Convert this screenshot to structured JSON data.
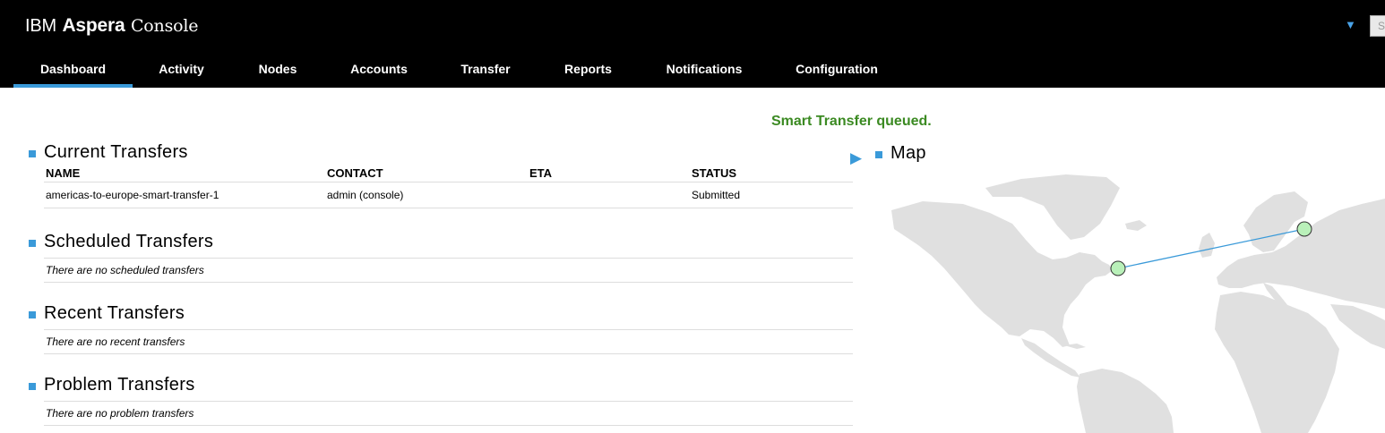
{
  "header": {
    "brand_ibm": "IBM",
    "brand_aspera": "Aspera",
    "brand_console": "Console",
    "search_stub": "S"
  },
  "nav": [
    {
      "label": "Dashboard",
      "active": true
    },
    {
      "label": "Activity"
    },
    {
      "label": "Nodes"
    },
    {
      "label": "Accounts"
    },
    {
      "label": "Transfer"
    },
    {
      "label": "Reports"
    },
    {
      "label": "Notifications"
    },
    {
      "label": "Configuration"
    }
  ],
  "status_message": "Smart Transfer queued.",
  "current_transfers": {
    "title": "Current Transfers",
    "columns": [
      "NAME",
      "CONTACT",
      "ETA",
      "STATUS"
    ],
    "rows": [
      {
        "name": "americas-to-europe-smart-transfer-1",
        "contact": "admin (console)",
        "eta": "",
        "status": "Submitted"
      }
    ]
  },
  "scheduled_transfers": {
    "title": "Scheduled Transfers",
    "empty": "There are no scheduled transfers"
  },
  "recent_transfers": {
    "title": "Recent Transfers",
    "empty": "There are no recent transfers"
  },
  "problem_transfers": {
    "title": "Problem Transfers",
    "empty": "There are no problem transfers"
  },
  "map": {
    "title": "Map",
    "land_color": "#e0e0e0",
    "route_color": "#3a9ad9",
    "node_color": "#b9f0b9"
  },
  "colors": {
    "accent": "#3a9ad9",
    "status_ok": "#3b8a22",
    "header_bg": "#000000"
  }
}
